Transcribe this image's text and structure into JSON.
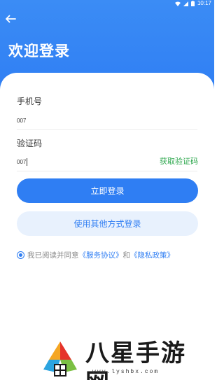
{
  "status_bar": {
    "time": "10:17"
  },
  "header": {
    "title": "欢迎登录"
  },
  "form": {
    "phone_label": "手机号",
    "phone_value": "007",
    "code_label": "验证码",
    "code_value": "007",
    "get_code_label": "获取验证码"
  },
  "actions": {
    "login_label": "立即登录",
    "other_login_label": "使用其他方式登录"
  },
  "agreement": {
    "prefix": "我已阅读并同意",
    "service_link": "《服务协议》",
    "connector": "和",
    "privacy_link": "《隐私政策》"
  },
  "watermark": {
    "name": "八星手游网",
    "url": "www.lyshbx.com"
  },
  "colors": {
    "primary": "#2f7ef3",
    "secondary_bg": "#e8f1fd",
    "link_green": "#2fa84f"
  }
}
